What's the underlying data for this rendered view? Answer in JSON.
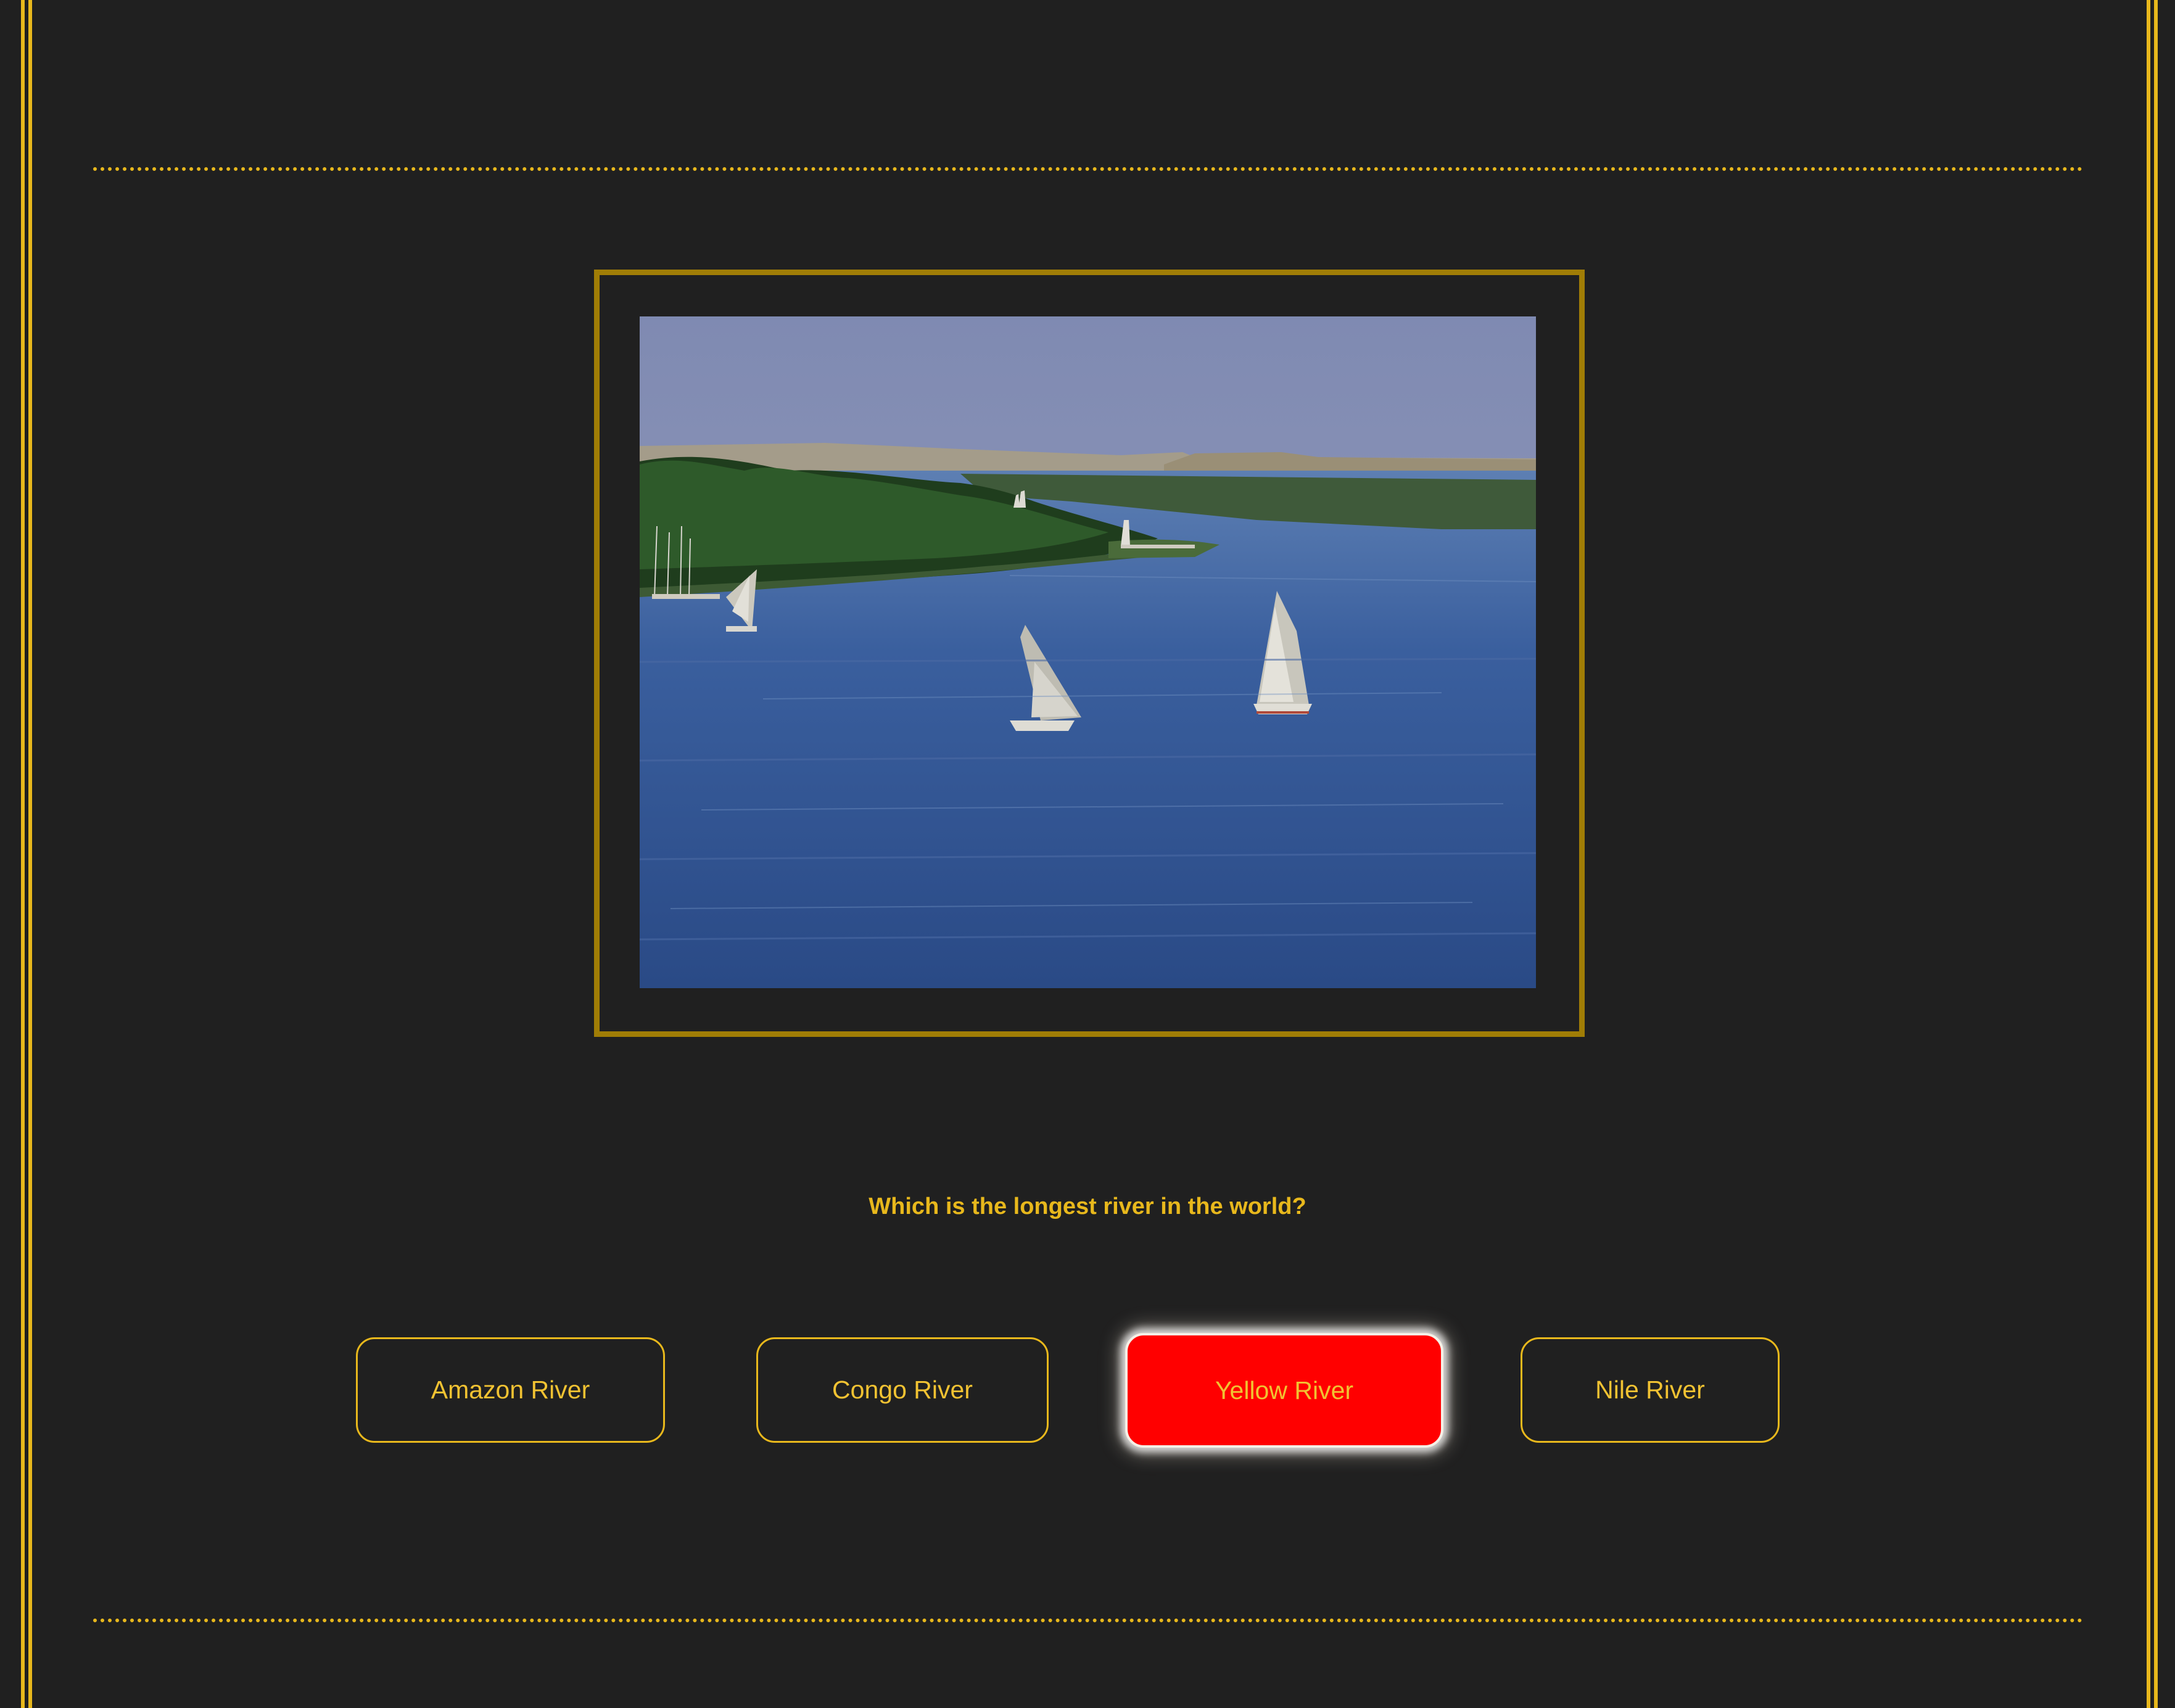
{
  "quiz": {
    "question": "Which is the longest river in the world?",
    "image_alt": "Sailboats on a wide river",
    "answers": [
      {
        "label": "Amazon River",
        "state": "default"
      },
      {
        "label": "Congo River",
        "state": "default"
      },
      {
        "label": "Yellow River",
        "state": "selected-incorrect"
      },
      {
        "label": "Nile River",
        "state": "default"
      }
    ]
  },
  "colors": {
    "background": "#202020",
    "accent": "#e8b81c",
    "photo_border": "#a07d06",
    "selected_button": "#ff0000"
  }
}
